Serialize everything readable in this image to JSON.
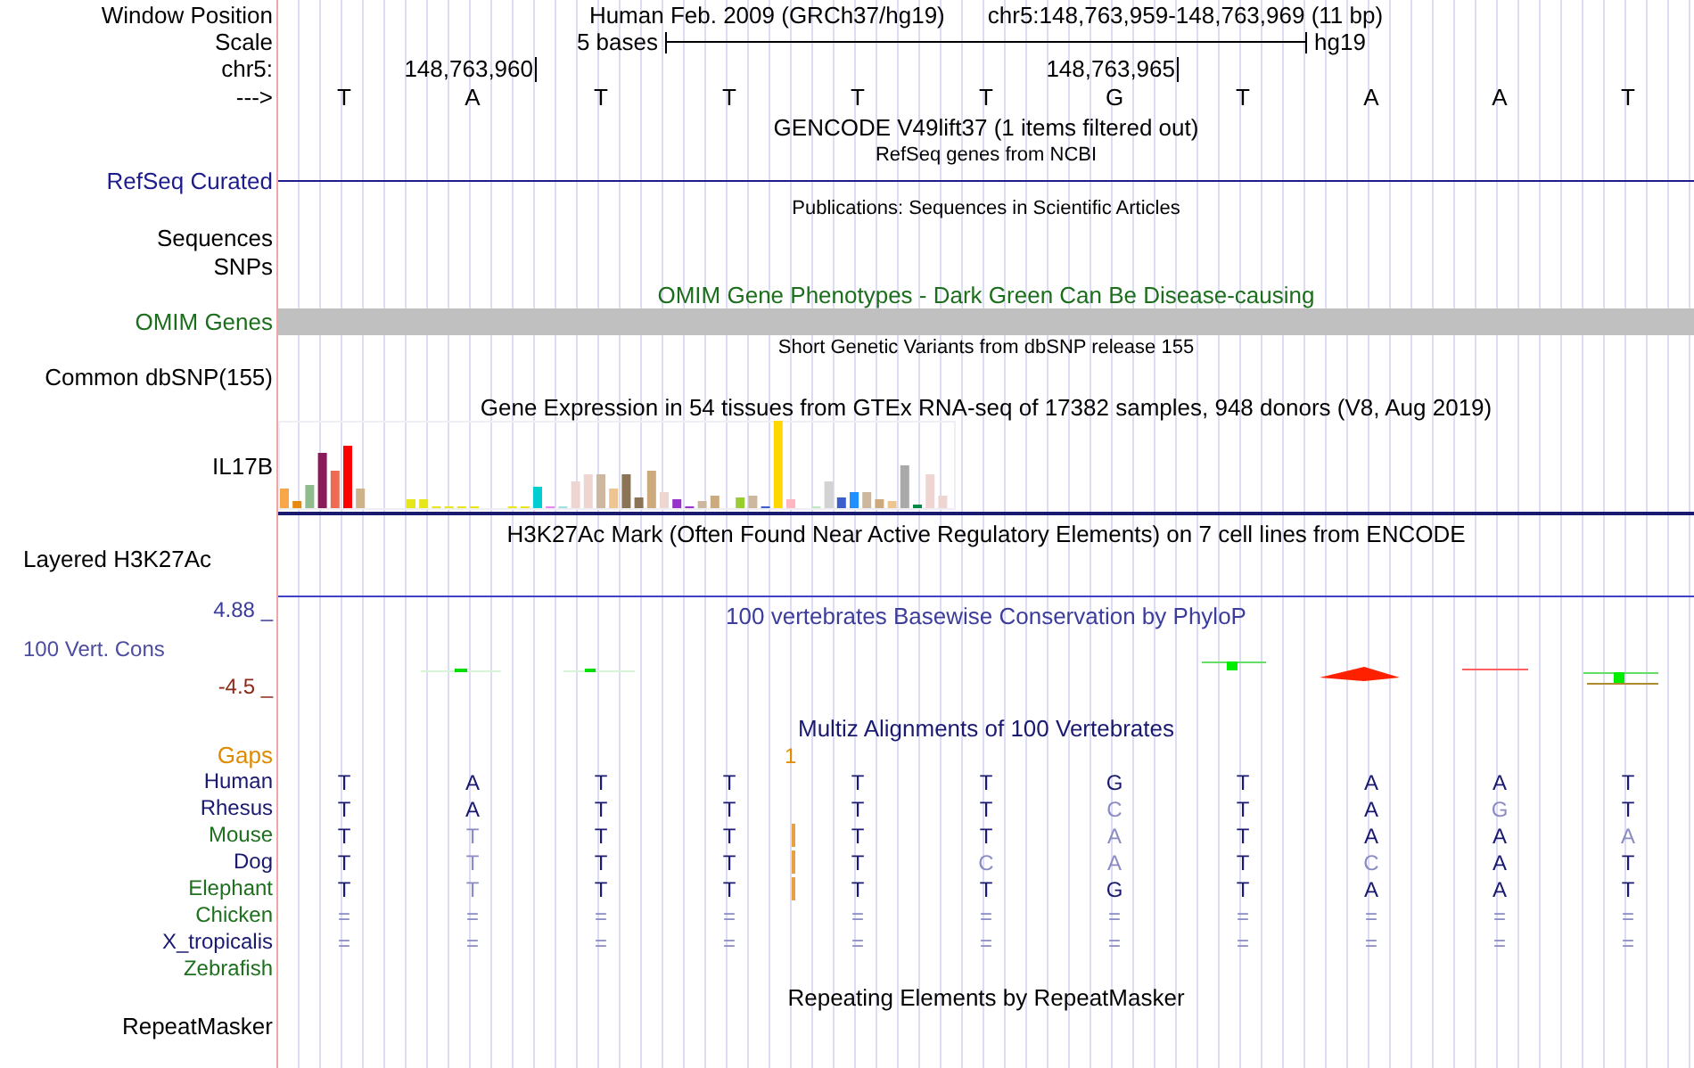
{
  "position": {
    "label": "Window Position",
    "assembly": "Human Feb. 2009 (GRCh37/hg19)",
    "range": "chr5:148,763,959-148,763,969 (11 bp)"
  },
  "scale": {
    "label": "Scale",
    "span": "5 bases",
    "assembly": "hg19"
  },
  "coordinates": {
    "label": "chr5:",
    "ticks": [
      "148,763,960",
      "148,763,965"
    ]
  },
  "sequence": {
    "label": "--->",
    "bases": [
      "T",
      "A",
      "T",
      "T",
      "T",
      "T",
      "G",
      "T",
      "A",
      "A",
      "T"
    ]
  },
  "gencode": {
    "title": "GENCODE V49lift37 (1 items filtered out)"
  },
  "refseq": {
    "subtitle": "RefSeq genes from NCBI",
    "label": "RefSeq Curated"
  },
  "publications": {
    "subtitle": "Publications: Sequences in Scientific Articles",
    "label": "Sequences"
  },
  "snps": {
    "label": "SNPs"
  },
  "omim": {
    "title": "OMIM Gene Phenotypes - Dark Green Can Be Disease-causing",
    "label": "OMIM Genes"
  },
  "dbsnp": {
    "subtitle": "Short Genetic Variants from dbSNP release 155",
    "label": "Common dbSNP(155)"
  },
  "gtex": {
    "title": "Gene Expression in 54 tissues from GTEx RNA-seq of 17382 samples, 948 donors (V8, Aug 2019)",
    "label": "IL17B"
  },
  "h3k27ac": {
    "title": "H3K27Ac Mark (Often Found Near Active Regulatory Elements) on 7 cell lines from ENCODE",
    "label": "Layered H3K27Ac"
  },
  "conservation": {
    "title": "100 vertebrates Basewise Conservation by PhyloP",
    "label": "100 Vert. Cons",
    "max": "4.88 _",
    "min": "-4.5 _"
  },
  "multiz": {
    "title": "Multiz Alignments of 100 Vertebrates",
    "gaps_label": "Gaps",
    "gap_count": "1",
    "species": [
      {
        "name": "Human",
        "color": "#191970",
        "insertion": false,
        "bases": [
          {
            "base": "T",
            "match": true
          },
          {
            "base": "A",
            "match": true
          },
          {
            "base": "T",
            "match": true
          },
          {
            "base": "T",
            "match": true
          },
          {
            "base": "T",
            "match": true
          },
          {
            "base": "T",
            "match": true
          },
          {
            "base": "G",
            "match": true
          },
          {
            "base": "T",
            "match": true
          },
          {
            "base": "A",
            "match": true
          },
          {
            "base": "A",
            "match": true
          },
          {
            "base": "T",
            "match": true
          }
        ]
      },
      {
        "name": "Rhesus",
        "color": "#191970",
        "insertion": false,
        "bases": [
          {
            "base": "T",
            "match": true
          },
          {
            "base": "A",
            "match": true
          },
          {
            "base": "T",
            "match": true
          },
          {
            "base": "T",
            "match": true
          },
          {
            "base": "T",
            "match": true
          },
          {
            "base": "T",
            "match": true
          },
          {
            "base": "C",
            "match": false
          },
          {
            "base": "T",
            "match": true
          },
          {
            "base": "A",
            "match": true
          },
          {
            "base": "G",
            "match": false
          },
          {
            "base": "T",
            "match": true
          }
        ]
      },
      {
        "name": "Mouse",
        "color": "#1e701e",
        "insertion": true,
        "bases": [
          {
            "base": "T",
            "match": true
          },
          {
            "base": "T",
            "match": false
          },
          {
            "base": "T",
            "match": true
          },
          {
            "base": "T",
            "match": true
          },
          {
            "base": "T",
            "match": true
          },
          {
            "base": "T",
            "match": true
          },
          {
            "base": "A",
            "match": false
          },
          {
            "base": "T",
            "match": true
          },
          {
            "base": "A",
            "match": true
          },
          {
            "base": "A",
            "match": true
          },
          {
            "base": "A",
            "match": false
          }
        ]
      },
      {
        "name": "Dog",
        "color": "#191970",
        "insertion": true,
        "bases": [
          {
            "base": "T",
            "match": true
          },
          {
            "base": "T",
            "match": false
          },
          {
            "base": "T",
            "match": true
          },
          {
            "base": "T",
            "match": true
          },
          {
            "base": "T",
            "match": true
          },
          {
            "base": "C",
            "match": false
          },
          {
            "base": "A",
            "match": false
          },
          {
            "base": "T",
            "match": true
          },
          {
            "base": "C",
            "match": false
          },
          {
            "base": "A",
            "match": true
          },
          {
            "base": "T",
            "match": true
          }
        ]
      },
      {
        "name": "Elephant",
        "color": "#1e701e",
        "insertion": true,
        "bases": [
          {
            "base": "T",
            "match": true
          },
          {
            "base": "T",
            "match": false
          },
          {
            "base": "T",
            "match": true
          },
          {
            "base": "T",
            "match": true
          },
          {
            "base": "T",
            "match": true
          },
          {
            "base": "T",
            "match": true
          },
          {
            "base": "G",
            "match": true
          },
          {
            "base": "T",
            "match": true
          },
          {
            "base": "A",
            "match": true
          },
          {
            "base": "A",
            "match": true
          },
          {
            "base": "T",
            "match": true
          }
        ]
      },
      {
        "name": "Chicken",
        "color": "#1e701e",
        "insertion": false,
        "bases": [
          {
            "base": "=",
            "match": false
          },
          {
            "base": "=",
            "match": false
          },
          {
            "base": "=",
            "match": false
          },
          {
            "base": "=",
            "match": false
          },
          {
            "base": "=",
            "match": false
          },
          {
            "base": "=",
            "match": false
          },
          {
            "base": "=",
            "match": false
          },
          {
            "base": "=",
            "match": false
          },
          {
            "base": "=",
            "match": false
          },
          {
            "base": "=",
            "match": false
          },
          {
            "base": "=",
            "match": false
          }
        ]
      },
      {
        "name": "X_tropicalis",
        "color": "#191970",
        "insertion": false,
        "bases": [
          {
            "base": "=",
            "match": false
          },
          {
            "base": "=",
            "match": false
          },
          {
            "base": "=",
            "match": false
          },
          {
            "base": "=",
            "match": false
          },
          {
            "base": "=",
            "match": false
          },
          {
            "base": "=",
            "match": false
          },
          {
            "base": "=",
            "match": false
          },
          {
            "base": "=",
            "match": false
          },
          {
            "base": "=",
            "match": false
          },
          {
            "base": "=",
            "match": false
          },
          {
            "base": "=",
            "match": false
          }
        ]
      },
      {
        "name": "Zebrafish",
        "color": "#1e701e",
        "insertion": false
      }
    ]
  },
  "repeatmasker": {
    "title": "Repeating Elements by RepeatMasker",
    "label": "RepeatMasker"
  }
}
